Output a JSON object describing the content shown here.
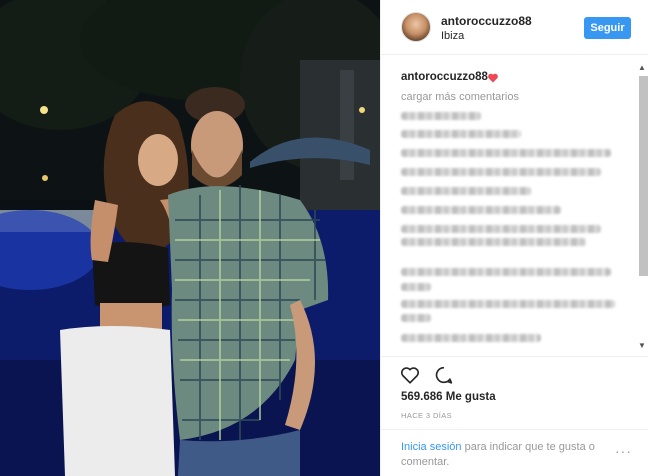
{
  "post": {
    "username": "antoroccuzzo88",
    "location": "Ibiza",
    "follow_label": "Seguir",
    "caption_user": "antoroccuzzo88",
    "load_more": "cargar más comentarios",
    "likes": "569.686 Me gusta",
    "time_ago": "HACE 3 DÍAS",
    "login_link": "Inicia sesión",
    "login_rest": " para indicar que te gusta o comentar.",
    "more_options": "···"
  },
  "colors": {
    "accent": "#3897f0",
    "heart": "#ed4956",
    "muted": "#999999"
  },
  "icons": [
    "heart-icon",
    "comment-icon",
    "more-options-icon",
    "avatar"
  ]
}
